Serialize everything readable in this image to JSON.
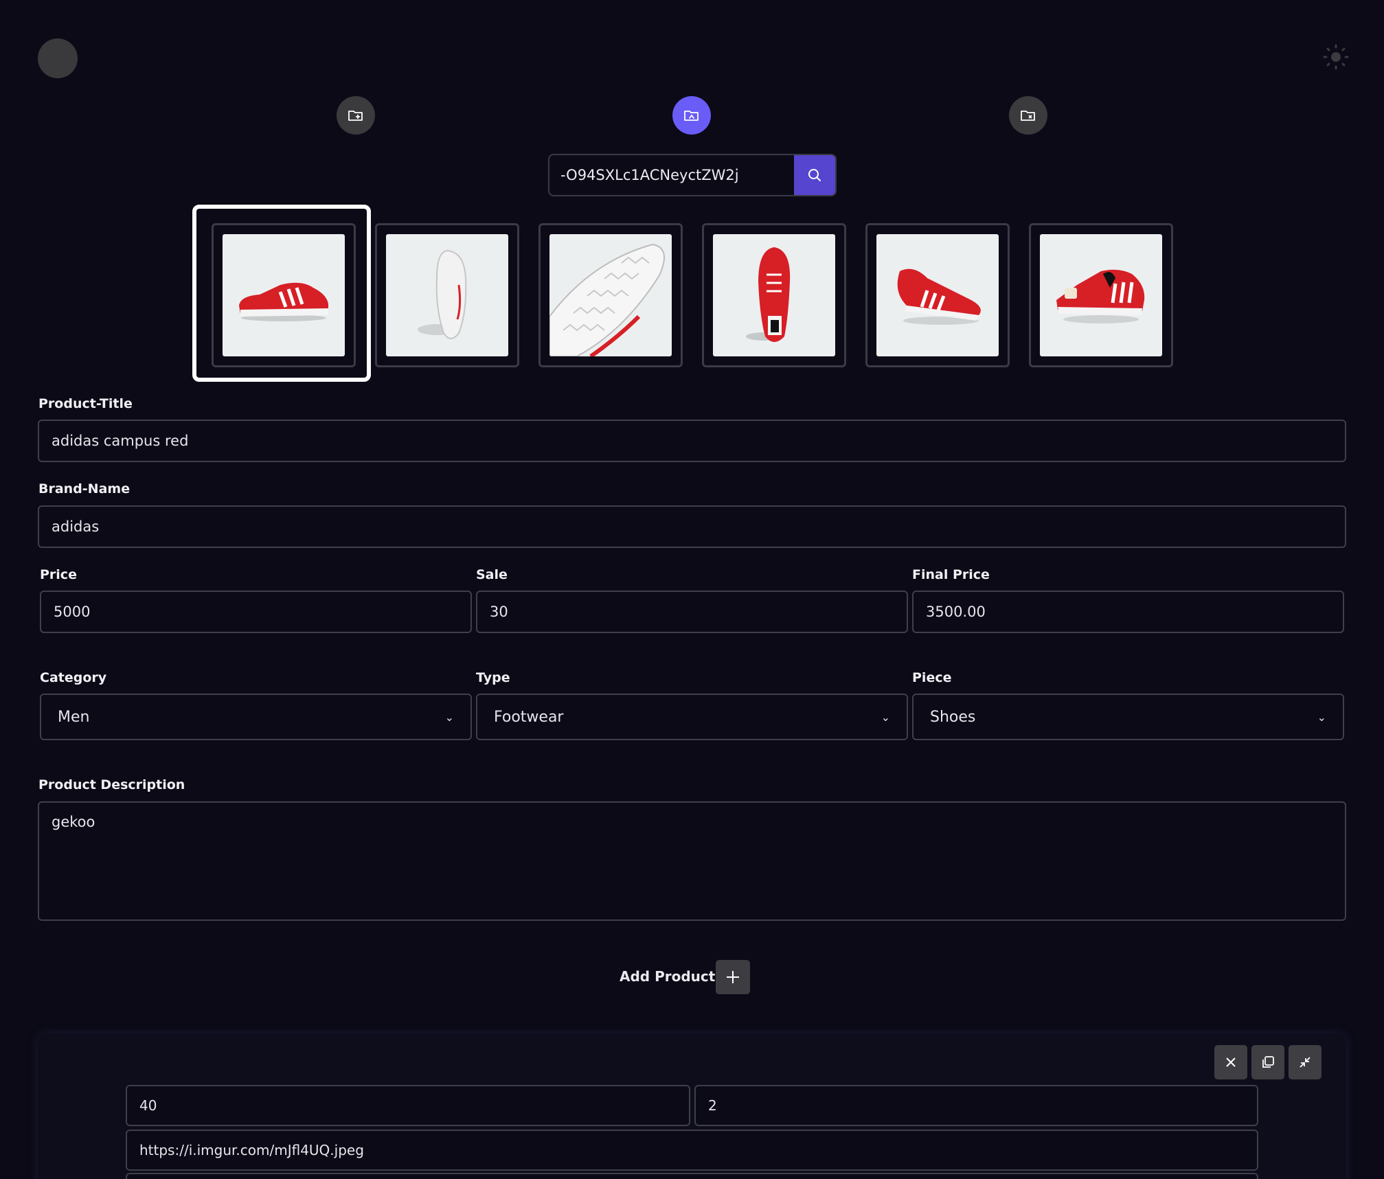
{
  "header": {
    "avatar_icon": "user-avatar",
    "theme_icon": "sun-icon"
  },
  "modes": [
    {
      "icon": "folder-add-icon",
      "active": false
    },
    {
      "icon": "folder-open-icon",
      "active": true
    },
    {
      "icon": "folder-remove-icon",
      "active": false
    }
  ],
  "search": {
    "value": "-O94SXLc1ACNeyctZW2j",
    "button_icon": "search-icon"
  },
  "thumbnails": [
    {
      "alt": "red sneaker side view",
      "selected": true
    },
    {
      "alt": "sneaker sole view",
      "selected": false
    },
    {
      "alt": "sneaker outsole",
      "selected": false
    },
    {
      "alt": "sneaker top view",
      "selected": false
    },
    {
      "alt": "sneaker pair angle",
      "selected": false
    },
    {
      "alt": "sneaker front angle",
      "selected": false
    }
  ],
  "form": {
    "title_label": "Product-Title",
    "title_value": "adidas campus red",
    "brand_label": "Brand-Name",
    "brand_value": "adidas",
    "price_label": "Price",
    "price_value": "5000",
    "sale_label": "Sale",
    "sale_value": "30",
    "final_label": "Final Price",
    "final_value": "3500.00",
    "category_label": "Category",
    "category_value": "Men",
    "type_label": "Type",
    "type_value": "Footwear",
    "piece_label": "Piece",
    "piece_value": "Shoes",
    "desc_label": "Product Description",
    "desc_value": "gekoo"
  },
  "add_products": {
    "label": "Add Products",
    "button_icon": "plus-icon"
  },
  "variant": {
    "size": "40",
    "quantity": "2",
    "image_url": "https://i.imgur.com/mJfl4UQ.jpeg",
    "buttons": [
      "close-icon",
      "copy-icon",
      "collapse-icon"
    ]
  },
  "colors": {
    "background": "#0b0a16",
    "accent": "#6a5cf6",
    "search_button": "#5645cf",
    "shoe_red": "#d71f26"
  }
}
